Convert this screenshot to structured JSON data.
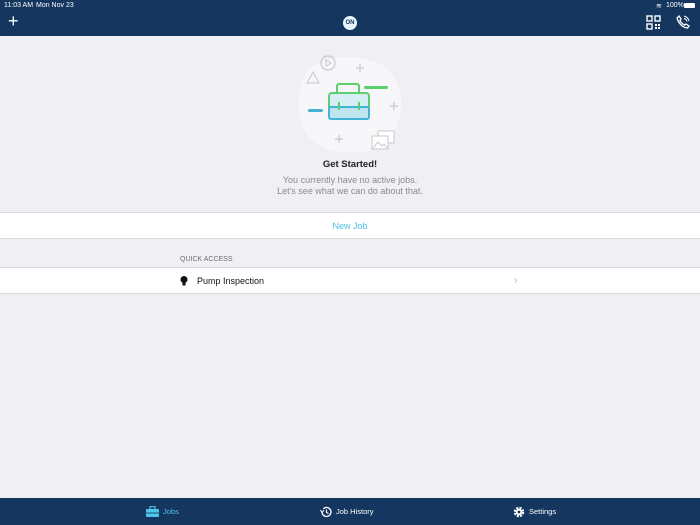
{
  "status_bar": {
    "time": "11:03 AM",
    "date": "Mon Nov 23",
    "battery": "100%"
  },
  "header": {
    "logo_text": "ON"
  },
  "empty_state": {
    "title": "Get Started!",
    "line1": "You currently have no active jobs.",
    "line2": "Let's see what we can do about that."
  },
  "new_job_label": "New Job",
  "quick_access": {
    "header": "QUICK ACCESS",
    "items": [
      {
        "label": "Pump Inspection",
        "icon": "lightbulb-icon"
      }
    ]
  },
  "tabs": [
    {
      "label": "Jobs",
      "icon": "toolbox-icon",
      "active": true
    },
    {
      "label": "Job History",
      "icon": "history-icon"
    },
    {
      "label": "Settings",
      "icon": "gear-icon"
    }
  ],
  "colors": {
    "header": "#15365e",
    "accent": "#4fc3e8",
    "background": "#efeff4"
  }
}
